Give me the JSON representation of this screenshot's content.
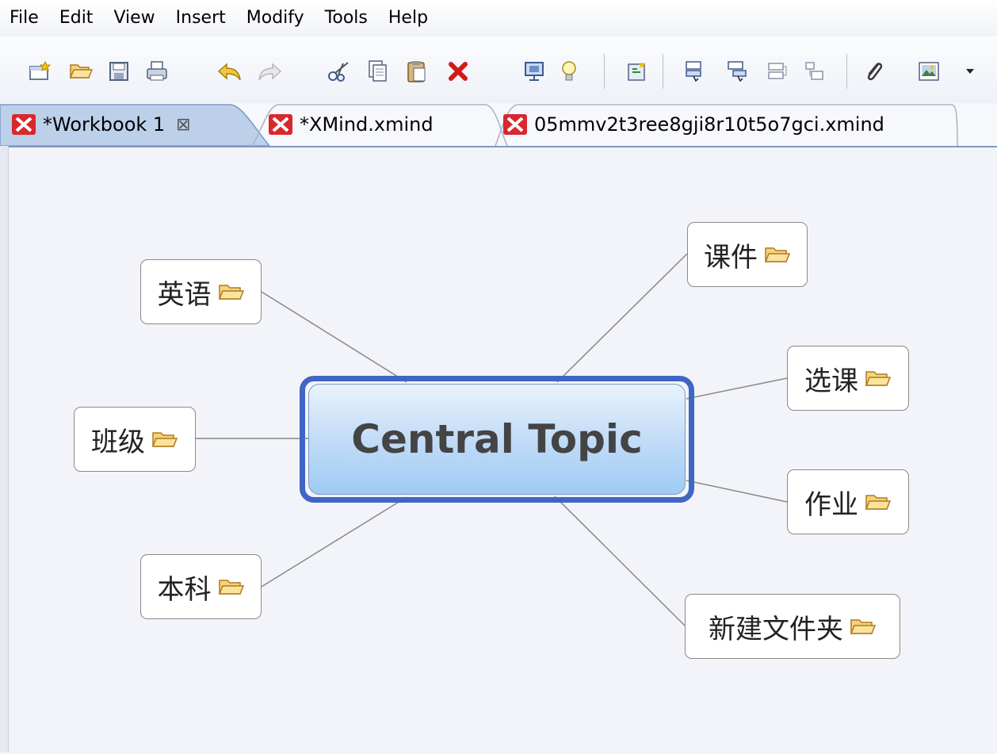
{
  "menu": [
    "File",
    "Edit",
    "View",
    "Insert",
    "Modify",
    "Tools",
    "Help"
  ],
  "tabs": [
    {
      "label": "*Workbook 1",
      "active": true,
      "close": "⊠"
    },
    {
      "label": "*XMind.xmind",
      "active": false
    },
    {
      "label": "05mmv2t3ree8gji8r10t5o7gci.xmind",
      "active": false
    }
  ],
  "toolbar_icons": [
    "new-icon",
    "open-icon",
    "save-icon",
    "print-icon",
    "undo-icon",
    "redo-icon",
    "cut-icon",
    "copy-icon",
    "paste-icon",
    "delete-icon",
    "presentation-icon",
    "idea-icon",
    "insert-topic-icon",
    "subtopic-icon",
    "topic-before-icon",
    "callout-icon",
    "summary-icon",
    "attachment-icon",
    "image-icon",
    "dropdown-icon"
  ],
  "central_topic": "Central Topic",
  "topics": {
    "kejian": "课件",
    "xuanke": "选课",
    "zuoye": "作业",
    "xinjian": "新建文件夹",
    "yingyu": "英语",
    "banji": "班级",
    "benke": "本科"
  },
  "colors": {
    "central_border": "#3f66c4",
    "central_fill_top": "#e9f3fd",
    "central_fill_bottom": "#9ecbf6",
    "canvas": "#f3f4f9",
    "tab_icon_red": "#d9272e",
    "folder_orange": "#f2b13c"
  }
}
